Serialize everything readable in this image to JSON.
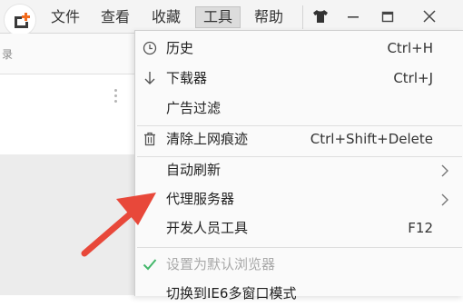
{
  "menubar": {
    "logo_icon": "browser-logo-icon",
    "items": [
      {
        "label": "文件"
      },
      {
        "label": "查看"
      },
      {
        "label": "收藏"
      },
      {
        "label": "工具"
      },
      {
        "label": "帮助"
      }
    ],
    "active_index": 3,
    "window_controls": [
      "skin-icon",
      "minimize-icon",
      "restore-icon",
      "close-icon"
    ]
  },
  "background": {
    "address_fragment": "录"
  },
  "tools_menu": {
    "items": [
      {
        "label": "历史",
        "shortcut": "Ctrl+H",
        "icon": "clock-icon"
      },
      {
        "label": "下载器",
        "shortcut": "Ctrl+J",
        "icon": "download-arrow-icon"
      },
      {
        "label": "广告过滤",
        "shortcut": ""
      },
      {
        "label": "清除上网痕迹",
        "shortcut": "Ctrl+Shift+Delete",
        "icon": "trash-icon"
      },
      {
        "label": "自动刷新",
        "submenu": true
      },
      {
        "label": "代理服务器",
        "submenu": true
      },
      {
        "label": "开发人员工具",
        "shortcut": "F12"
      },
      {
        "label": "设置为默认浏览器",
        "disabled": true,
        "icon": "checkmark-icon"
      },
      {
        "label": "切换到IE6多窗口模式"
      }
    ]
  },
  "colors": {
    "annotation_arrow": "#e8483a",
    "checkmark": "#43b76a",
    "logo_accent": "#f26b1d"
  }
}
